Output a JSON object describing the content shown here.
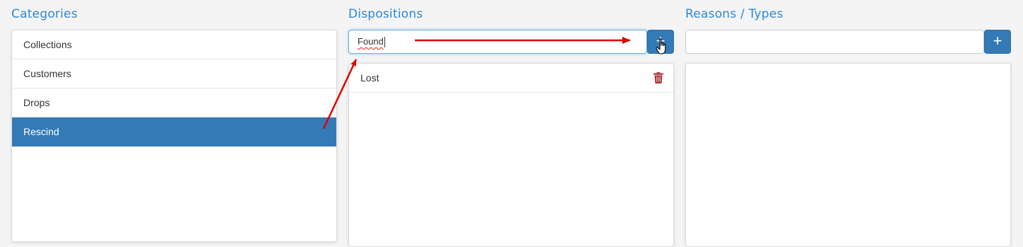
{
  "categories": {
    "title": "Categories",
    "items": [
      {
        "label": "Collections"
      },
      {
        "label": "Customers"
      },
      {
        "label": "Drops"
      },
      {
        "label": "Rescind"
      }
    ],
    "selected": "Rescind"
  },
  "dispositions": {
    "title": "Dispositions",
    "input_value": "Found",
    "add_label": "+",
    "items": [
      {
        "label": "Lost"
      }
    ]
  },
  "reasons": {
    "title": "Reasons / Types",
    "input_value": "",
    "add_label": "+"
  },
  "colors": {
    "accent": "#337ab7",
    "heading": "#2e86d4",
    "delete": "#b03a3a",
    "annotation": "#e00000"
  },
  "icons": {
    "delete": "trash-icon",
    "add": "plus-icon",
    "cursor": "hand-pointer-icon"
  }
}
